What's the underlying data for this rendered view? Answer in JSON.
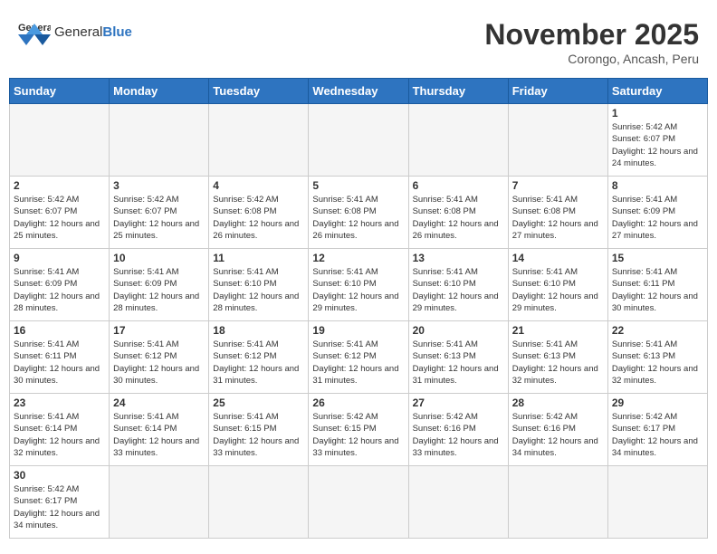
{
  "header": {
    "logo_general": "General",
    "logo_blue": "Blue",
    "month_title": "November 2025",
    "location": "Corongo, Ancash, Peru"
  },
  "weekdays": [
    "Sunday",
    "Monday",
    "Tuesday",
    "Wednesday",
    "Thursday",
    "Friday",
    "Saturday"
  ],
  "weeks": [
    [
      {
        "day": "",
        "info": ""
      },
      {
        "day": "",
        "info": ""
      },
      {
        "day": "",
        "info": ""
      },
      {
        "day": "",
        "info": ""
      },
      {
        "day": "",
        "info": ""
      },
      {
        "day": "",
        "info": ""
      },
      {
        "day": "1",
        "info": "Sunrise: 5:42 AM\nSunset: 6:07 PM\nDaylight: 12 hours and 24 minutes."
      }
    ],
    [
      {
        "day": "2",
        "info": "Sunrise: 5:42 AM\nSunset: 6:07 PM\nDaylight: 12 hours and 25 minutes."
      },
      {
        "day": "3",
        "info": "Sunrise: 5:42 AM\nSunset: 6:07 PM\nDaylight: 12 hours and 25 minutes."
      },
      {
        "day": "4",
        "info": "Sunrise: 5:42 AM\nSunset: 6:08 PM\nDaylight: 12 hours and 26 minutes."
      },
      {
        "day": "5",
        "info": "Sunrise: 5:41 AM\nSunset: 6:08 PM\nDaylight: 12 hours and 26 minutes."
      },
      {
        "day": "6",
        "info": "Sunrise: 5:41 AM\nSunset: 6:08 PM\nDaylight: 12 hours and 26 minutes."
      },
      {
        "day": "7",
        "info": "Sunrise: 5:41 AM\nSunset: 6:08 PM\nDaylight: 12 hours and 27 minutes."
      },
      {
        "day": "8",
        "info": "Sunrise: 5:41 AM\nSunset: 6:09 PM\nDaylight: 12 hours and 27 minutes."
      }
    ],
    [
      {
        "day": "9",
        "info": "Sunrise: 5:41 AM\nSunset: 6:09 PM\nDaylight: 12 hours and 28 minutes."
      },
      {
        "day": "10",
        "info": "Sunrise: 5:41 AM\nSunset: 6:09 PM\nDaylight: 12 hours and 28 minutes."
      },
      {
        "day": "11",
        "info": "Sunrise: 5:41 AM\nSunset: 6:10 PM\nDaylight: 12 hours and 28 minutes."
      },
      {
        "day": "12",
        "info": "Sunrise: 5:41 AM\nSunset: 6:10 PM\nDaylight: 12 hours and 29 minutes."
      },
      {
        "day": "13",
        "info": "Sunrise: 5:41 AM\nSunset: 6:10 PM\nDaylight: 12 hours and 29 minutes."
      },
      {
        "day": "14",
        "info": "Sunrise: 5:41 AM\nSunset: 6:10 PM\nDaylight: 12 hours and 29 minutes."
      },
      {
        "day": "15",
        "info": "Sunrise: 5:41 AM\nSunset: 6:11 PM\nDaylight: 12 hours and 30 minutes."
      }
    ],
    [
      {
        "day": "16",
        "info": "Sunrise: 5:41 AM\nSunset: 6:11 PM\nDaylight: 12 hours and 30 minutes."
      },
      {
        "day": "17",
        "info": "Sunrise: 5:41 AM\nSunset: 6:12 PM\nDaylight: 12 hours and 30 minutes."
      },
      {
        "day": "18",
        "info": "Sunrise: 5:41 AM\nSunset: 6:12 PM\nDaylight: 12 hours and 31 minutes."
      },
      {
        "day": "19",
        "info": "Sunrise: 5:41 AM\nSunset: 6:12 PM\nDaylight: 12 hours and 31 minutes."
      },
      {
        "day": "20",
        "info": "Sunrise: 5:41 AM\nSunset: 6:13 PM\nDaylight: 12 hours and 31 minutes."
      },
      {
        "day": "21",
        "info": "Sunrise: 5:41 AM\nSunset: 6:13 PM\nDaylight: 12 hours and 32 minutes."
      },
      {
        "day": "22",
        "info": "Sunrise: 5:41 AM\nSunset: 6:13 PM\nDaylight: 12 hours and 32 minutes."
      }
    ],
    [
      {
        "day": "23",
        "info": "Sunrise: 5:41 AM\nSunset: 6:14 PM\nDaylight: 12 hours and 32 minutes."
      },
      {
        "day": "24",
        "info": "Sunrise: 5:41 AM\nSunset: 6:14 PM\nDaylight: 12 hours and 33 minutes."
      },
      {
        "day": "25",
        "info": "Sunrise: 5:41 AM\nSunset: 6:15 PM\nDaylight: 12 hours and 33 minutes."
      },
      {
        "day": "26",
        "info": "Sunrise: 5:42 AM\nSunset: 6:15 PM\nDaylight: 12 hours and 33 minutes."
      },
      {
        "day": "27",
        "info": "Sunrise: 5:42 AM\nSunset: 6:16 PM\nDaylight: 12 hours and 33 minutes."
      },
      {
        "day": "28",
        "info": "Sunrise: 5:42 AM\nSunset: 6:16 PM\nDaylight: 12 hours and 34 minutes."
      },
      {
        "day": "29",
        "info": "Sunrise: 5:42 AM\nSunset: 6:17 PM\nDaylight: 12 hours and 34 minutes."
      }
    ],
    [
      {
        "day": "30",
        "info": "Sunrise: 5:42 AM\nSunset: 6:17 PM\nDaylight: 12 hours and 34 minutes."
      },
      {
        "day": "",
        "info": ""
      },
      {
        "day": "",
        "info": ""
      },
      {
        "day": "",
        "info": ""
      },
      {
        "day": "",
        "info": ""
      },
      {
        "day": "",
        "info": ""
      },
      {
        "day": "",
        "info": ""
      }
    ]
  ]
}
